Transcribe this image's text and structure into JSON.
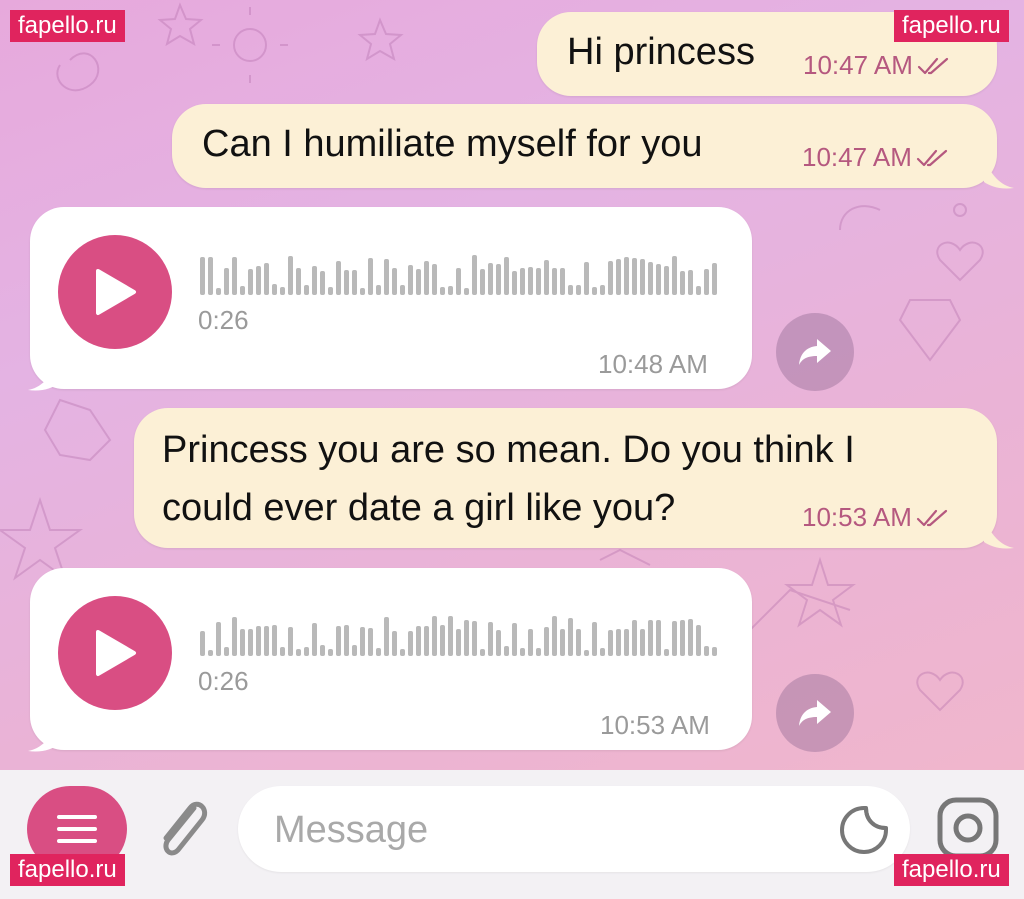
{
  "watermarks": {
    "top_left": "fapello.ru",
    "top_right": "fapello.ru",
    "bottom_left": "fapello.ru",
    "bottom_right": "fapello.ru"
  },
  "messages": [
    {
      "direction": "outgoing",
      "type": "text",
      "text": "Hi princess",
      "time": "10:47 AM",
      "status": "read"
    },
    {
      "direction": "outgoing",
      "type": "text",
      "text": "Can I humiliate myself for you",
      "time": "10:47 AM",
      "status": "read"
    },
    {
      "direction": "incoming",
      "type": "voice",
      "duration": "0:26",
      "time": "10:48 AM"
    },
    {
      "direction": "outgoing",
      "type": "text",
      "text_line1": "Princess you are so mean. Do you think I",
      "text_line2": "could ever date a girl like you?",
      "time": "10:53 AM",
      "status": "read"
    },
    {
      "direction": "incoming",
      "type": "voice",
      "duration": "0:26",
      "time": "10:53 AM"
    }
  ],
  "composer": {
    "placeholder": "Message",
    "menu_icon": "menu-icon",
    "attach_icon": "paperclip-icon",
    "sticker_icon": "sticker-icon",
    "camera_icon": "camera-icon"
  },
  "colors": {
    "outgoing_bubble": "#fcf0d6",
    "incoming_bubble": "#ffffff",
    "accent": "#d94e83",
    "timestamp_out": "#b5587f"
  }
}
